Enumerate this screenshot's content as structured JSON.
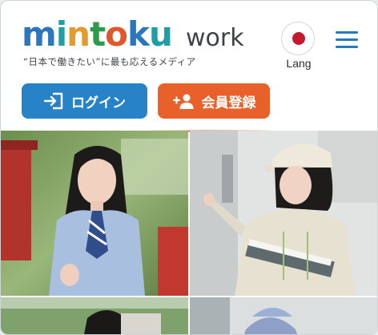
{
  "header": {
    "logo_letters": [
      "m",
      "i",
      "n",
      "t",
      "o",
      "k",
      "u"
    ],
    "logo_colors": [
      "#2b76be",
      "#1e9ea6",
      "#e59a2c",
      "#2f9a4e",
      "#e0572b",
      "#2b76be",
      "#1e9ea6"
    ],
    "logo_suffix": "work",
    "tagline": "“日本で働きたい”に最も応えるメディア",
    "lang_label": "Lang"
  },
  "actions": {
    "login_label": "ログイン",
    "register_label": "会員登録"
  },
  "colors": {
    "brand_blue": "#2882c7",
    "brand_orange": "#e8612a",
    "japan_red": "#c51a2b"
  }
}
